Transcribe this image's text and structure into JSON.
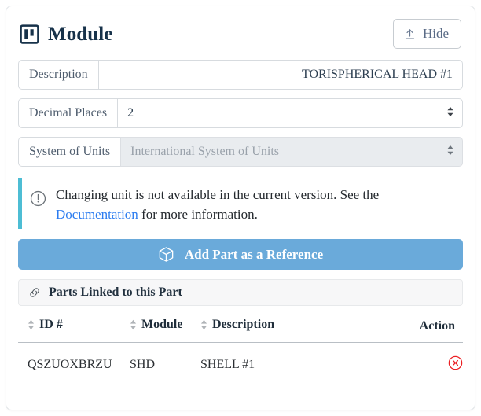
{
  "header": {
    "title": "Module",
    "icon": "module-icon",
    "hide_button": {
      "label": "Hide",
      "icon": "upload-arrow-icon"
    }
  },
  "fields": {
    "description": {
      "label": "Description",
      "value": "TORISPHERICAL HEAD #1"
    },
    "decimal_places": {
      "label": "Decimal Places",
      "value": "2"
    },
    "system_of_units": {
      "label": "System of Units",
      "value": "International System of Units",
      "disabled": true
    }
  },
  "alert": {
    "icon": "exclamation-circle-icon",
    "text_before": "Changing unit is not available in the current version. See the ",
    "link_label": "Documentation",
    "text_after": " for more information.",
    "accent_color": "#4dbdd4"
  },
  "add_reference_button": {
    "label": "Add Part as a Reference",
    "icon": "cube-icon",
    "color": "#6aaada"
  },
  "linked_panel": {
    "title": "Parts Linked to this Part",
    "icon": "link-icon"
  },
  "table": {
    "columns": [
      {
        "label": "ID #",
        "sortable": true
      },
      {
        "label": "Module",
        "sortable": true
      },
      {
        "label": "Description",
        "sortable": true
      },
      {
        "label": "Action",
        "sortable": false
      }
    ],
    "rows": [
      {
        "id": "QSZUOXBRZU",
        "module": "SHD",
        "description": "SHELL #1",
        "action_icon": "delete-circle-icon",
        "action_color": "#ec2024"
      }
    ]
  }
}
